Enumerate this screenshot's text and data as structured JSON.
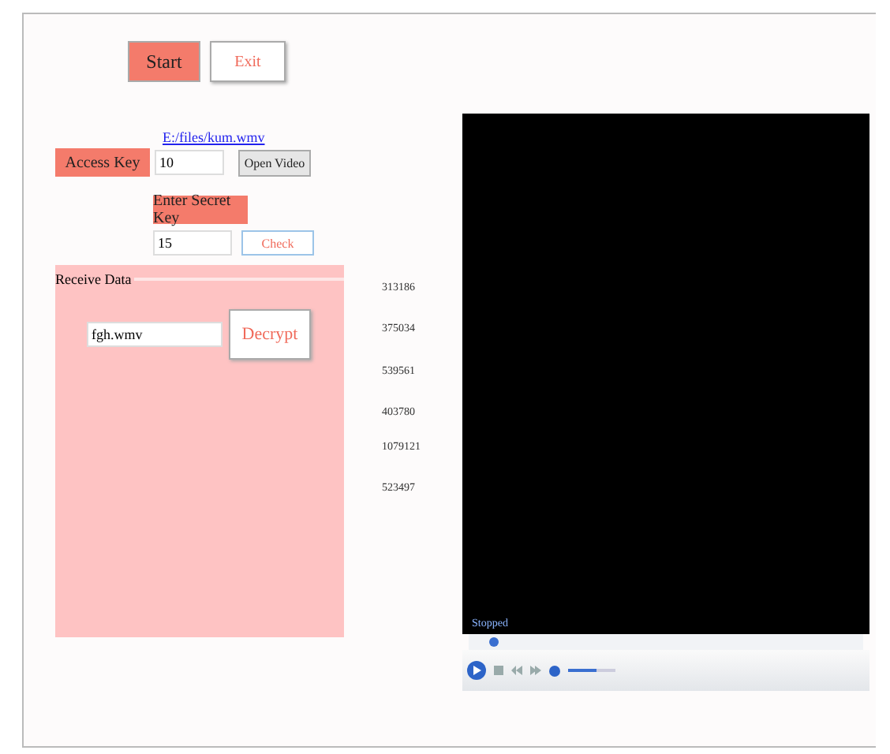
{
  "buttons": {
    "start": "Start",
    "exit": "Exit"
  },
  "file_link": "E:/files/kum.wmv",
  "access_key": {
    "label": "Access Key",
    "value": "10",
    "button": "Open Video"
  },
  "secret_key": {
    "label": "Enter Secret Key",
    "value": "15",
    "button": "Check"
  },
  "receive_panel": {
    "title": "Receive Data",
    "file_value": "fgh.wmv",
    "button": "Decrypt"
  },
  "numbers": [
    "313186",
    "375034",
    "539561",
    "403780",
    "1079121",
    "523497"
  ],
  "player": {
    "status": "Stopped",
    "seek": {
      "level": 0.05
    },
    "volume": {
      "level": 0.6
    }
  }
}
